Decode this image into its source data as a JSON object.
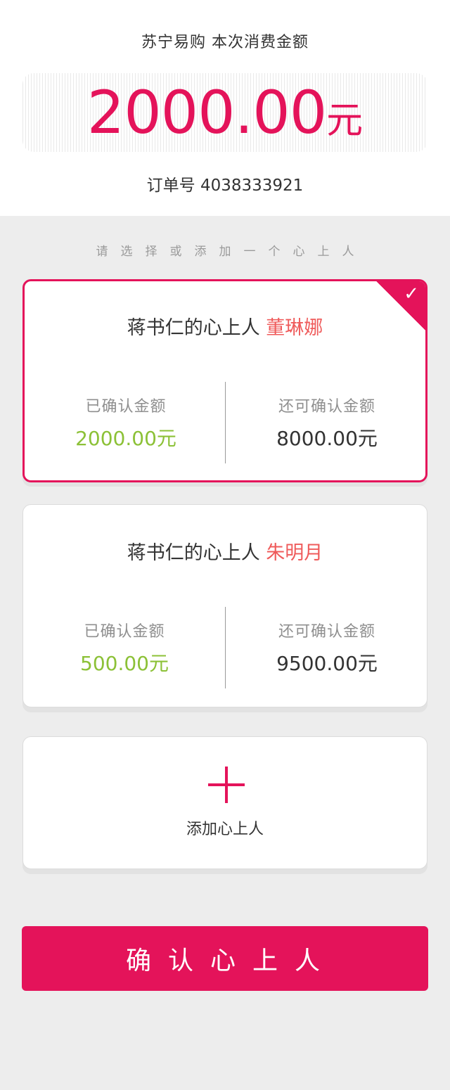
{
  "header": {
    "title": "苏宁易购 本次消费金额",
    "amount": "2000.00",
    "amount_unit": "元",
    "order_label": "订单号",
    "order_number": "4038333921"
  },
  "prompt": "请选择或添加一个心上人",
  "cards": [
    {
      "title_prefix": "蒋书仁的心上人",
      "name": "董琳娜",
      "selected": true,
      "confirmed_label": "已确认金额",
      "confirmed_value": "2000.00元",
      "remaining_label": "还可确认金额",
      "remaining_value": "8000.00元"
    },
    {
      "title_prefix": "蒋书仁的心上人",
      "name": "朱明月",
      "selected": false,
      "confirmed_label": "已确认金额",
      "confirmed_value": "500.00元",
      "remaining_label": "还可确认金额",
      "remaining_value": "9500.00元"
    }
  ],
  "add_card": {
    "label": "添加心上人",
    "icon": "plus-icon"
  },
  "confirm_button": {
    "label": "确认心上人"
  },
  "colors": {
    "accent": "#e4135a",
    "name": "#ef5b5b",
    "confirmed_value": "#8cc137",
    "background": "#ededed"
  },
  "icons": {
    "selected_check": "check-icon"
  }
}
